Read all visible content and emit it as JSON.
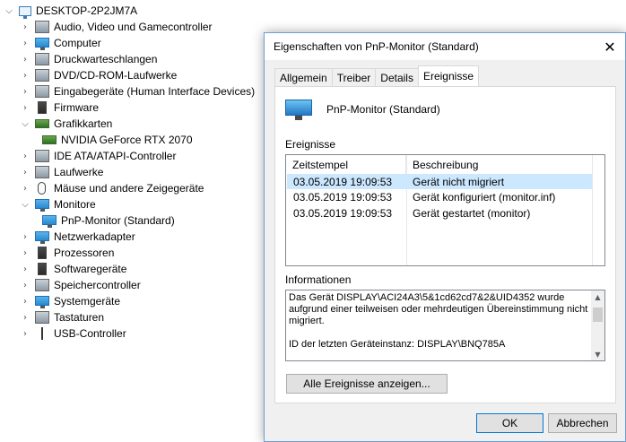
{
  "tree": {
    "root": "DESKTOP-2P2JM7A",
    "items": [
      {
        "label": "Audio, Video und Gamecontroller",
        "icon": "speaker-icon"
      },
      {
        "label": "Computer",
        "icon": "computer-icon"
      },
      {
        "label": "Druckwarteschlangen",
        "icon": "printer-icon"
      },
      {
        "label": "DVD/CD-ROM-Laufwerke",
        "icon": "disc-drive-icon"
      },
      {
        "label": "Eingabegeräte (Human Interface Devices)",
        "icon": "hid-icon"
      },
      {
        "label": "Firmware",
        "icon": "firmware-icon"
      },
      {
        "label": "Grafikkarten",
        "icon": "display-adapter-icon"
      },
      {
        "label": "NVIDIA GeForce RTX 2070",
        "icon": "graphics-card-icon"
      },
      {
        "label": "IDE ATA/ATAPI-Controller",
        "icon": "ide-controller-icon"
      },
      {
        "label": "Laufwerke",
        "icon": "disk-drive-icon"
      },
      {
        "label": "Mäuse und andere Zeigegeräte",
        "icon": "mouse-icon"
      },
      {
        "label": "Monitore",
        "icon": "monitor-icon"
      },
      {
        "label": "PnP-Monitor (Standard)",
        "icon": "monitor-icon"
      },
      {
        "label": "Netzwerkadapter",
        "icon": "network-adapter-icon"
      },
      {
        "label": "Prozessoren",
        "icon": "processor-icon"
      },
      {
        "label": "Softwaregeräte",
        "icon": "software-device-icon"
      },
      {
        "label": "Speichercontroller",
        "icon": "storage-controller-icon"
      },
      {
        "label": "Systemgeräte",
        "icon": "system-device-icon"
      },
      {
        "label": "Tastaturen",
        "icon": "keyboard-icon"
      },
      {
        "label": "USB-Controller",
        "icon": "usb-icon"
      }
    ]
  },
  "dialog": {
    "title": "Eigenschaften von PnP-Monitor (Standard)",
    "close_glyph": "✕",
    "tabs": [
      "Allgemein",
      "Treiber",
      "Details",
      "Ereignisse"
    ],
    "active_tab": "Ereignisse",
    "device_name": "PnP-Monitor (Standard)",
    "events_label": "Ereignisse",
    "columns": [
      "Zeitstempel",
      "Beschreibung"
    ],
    "rows": [
      {
        "time": "03.05.2019 19:09:53",
        "desc": "Gerät nicht migriert",
        "selected": true
      },
      {
        "time": "03.05.2019 19:09:53",
        "desc": "Gerät konfiguriert (monitor.inf)",
        "selected": false
      },
      {
        "time": "03.05.2019 19:09:53",
        "desc": "Gerät gestartet (monitor)",
        "selected": false
      }
    ],
    "info_label": "Informationen",
    "info_text_1": "Das Gerät DISPLAY\\ACI24A3\\5&1cd62cd7&2&UID4352 wurde aufgrund einer teilweisen oder mehrdeutigen Übereinstimmung nicht migriert.",
    "info_text_2": "ID der letzten Geräteinstanz: DISPLAY\\BNQ785A",
    "show_all_events": "Alle Ereignisse anzeigen...",
    "ok": "OK",
    "cancel": "Abbrechen"
  }
}
